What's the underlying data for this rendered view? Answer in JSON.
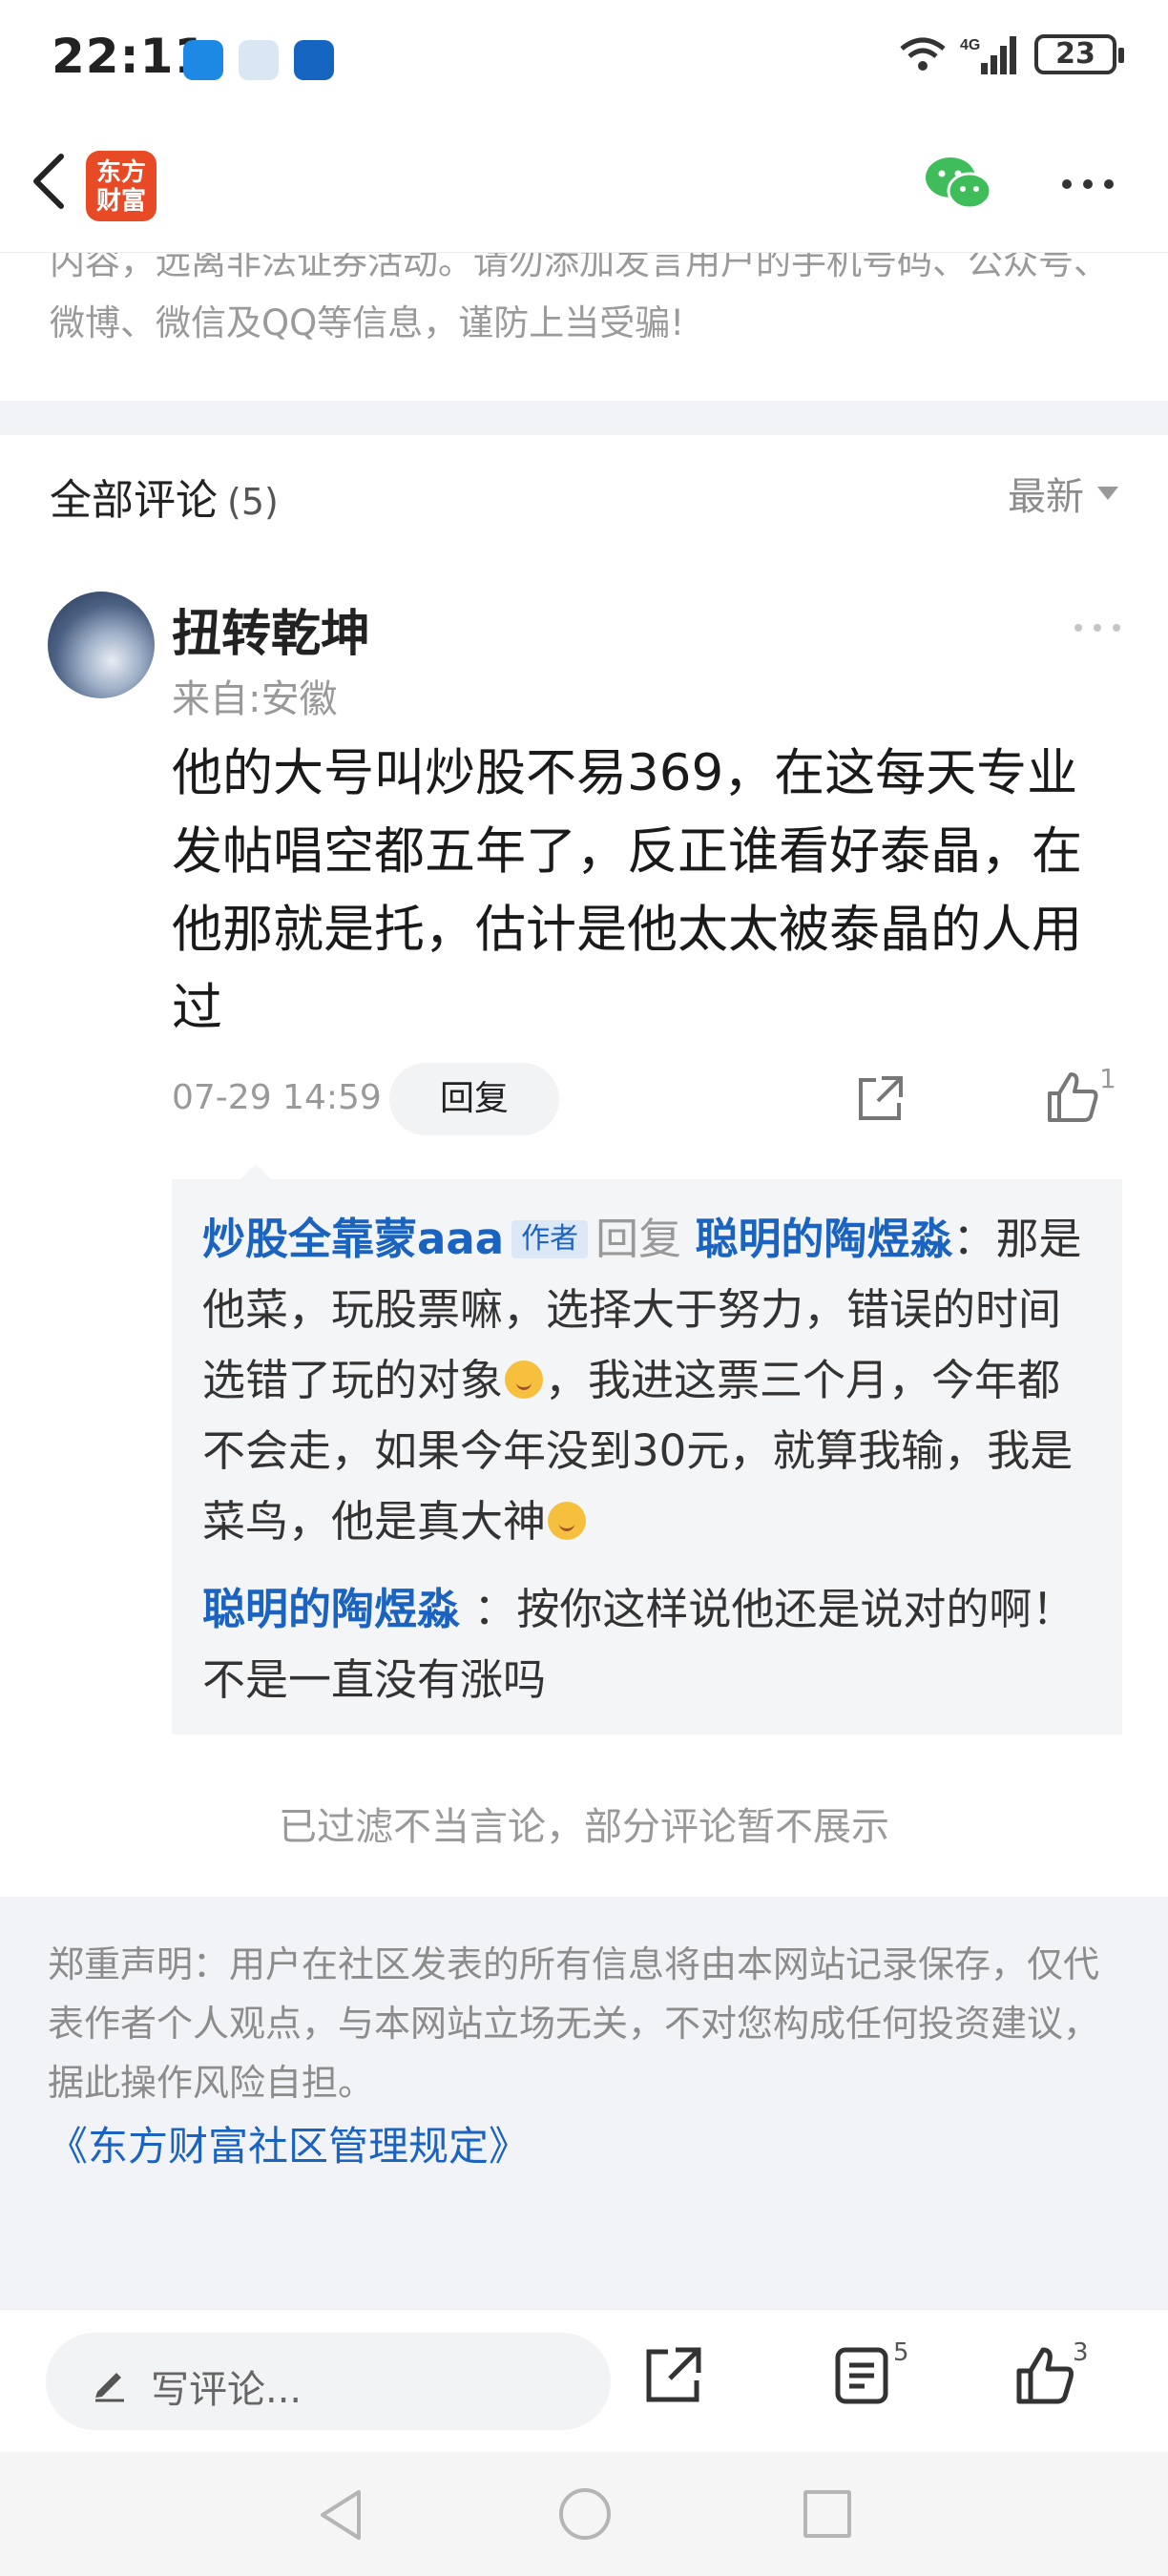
{
  "status_bar": {
    "time": "22:11",
    "network": "4G",
    "battery": "23",
    "app_icons": [
      "weather-icon",
      "browser-icon",
      "lightbulb-icon"
    ]
  },
  "nav": {
    "logo_text": "东方\n财富",
    "logo_color": "#e84a25",
    "icons": [
      "back-icon",
      "wechat-icon",
      "more-icon"
    ]
  },
  "notice": {
    "text": "内容，远离非法证券活动。请勿添加发言用户的手机号码、公众号、微博、微信及QQ等信息，谨防上当受骗!"
  },
  "comments_header": {
    "title": "全部评论",
    "count": "(5)",
    "sort_label": "最新"
  },
  "comment": {
    "username": "扭转乾坤",
    "location": "来自:安徽",
    "body": "他的大号叫炒股不易369，在这每天专业发帖唱空都五年了，反正谁看好泰晶，在他那就是托，估计是他太太被泰晶的人用过",
    "time": "07-29 14:59",
    "reply_label": "回复",
    "like_count": "1"
  },
  "replies": [
    {
      "author": "炒股全靠蒙aaa",
      "badge": "作者",
      "reply_word": "回复",
      "target": "聪明的陶煜淼",
      "separator": "：",
      "text_part1": "那是他菜，玩股票嘛，选择大于努力，错误的时间选错了玩的对象",
      "text_part2": "，我进这票三个月，今年都不会走，如果今年没到30元，就算我输，我是菜鸟，他是真大神"
    },
    {
      "author": "聪明的陶煜淼",
      "separator": "：",
      "text": "按你这样说他还是说对的啊！不是一直没有涨吗"
    }
  ],
  "filtered_note": "已过滤不当言论，部分评论暂不展示",
  "disclaimer": {
    "text": "郑重声明：用户在社区发表的所有信息将由本网站记录保存，仅代表作者个人观点，与本网站立场无关，不对您构成任何投资建议，据此操作风险自担。",
    "link": "《东方财富社区管理规定》"
  },
  "bottom_bar": {
    "input_placeholder": "写评论...",
    "comments_badge": "5",
    "likes_badge": "3"
  },
  "colors": {
    "link_blue": "#1a63c1",
    "muted_gray": "#999999",
    "band_gray": "#f2f3f6"
  }
}
